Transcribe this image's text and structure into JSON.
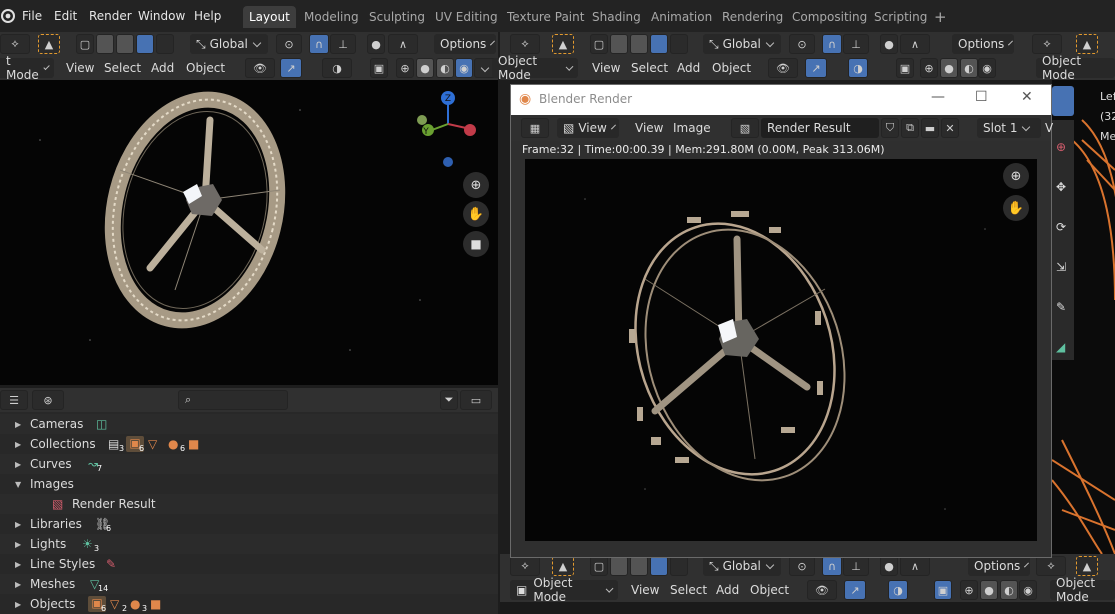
{
  "topbar": {
    "menus": [
      "File",
      "Edit",
      "Render",
      "Window",
      "Help"
    ],
    "workspaces": [
      "Layout",
      "Modeling",
      "Sculpting",
      "UV Editing",
      "Texture Paint",
      "Shading",
      "Animation",
      "Rendering",
      "Compositing",
      "Scripting"
    ],
    "active_workspace": "Layout",
    "add_tab": "+"
  },
  "tool_header": {
    "transform_orientation": "Global",
    "options_label": "Options"
  },
  "viewport_header": {
    "mode": "Object Mode",
    "mode_truncated": "t Mode",
    "menus": [
      "View",
      "Select",
      "Add",
      "Object"
    ]
  },
  "gizmo": {
    "z_label": "Z",
    "y_label": "Y"
  },
  "render_window": {
    "title": "Blender Render",
    "controls": {
      "minimize": "—",
      "maximize": "☐",
      "close": "✕"
    },
    "view_dropdown": "View",
    "menus": [
      "View",
      "Image"
    ],
    "image_name": "Render Result",
    "slot": "Slot 1",
    "slot_cut": "V",
    "stats": "Frame:32 | Time:00:00.39 | Mem:291.80M (0.00M, Peak 313.06M)"
  },
  "outliner": {
    "search_placeholder": "",
    "rows": [
      {
        "label": "Cameras",
        "expanded": false,
        "count": ""
      },
      {
        "label": "Collections",
        "expanded": false,
        "count": "3"
      },
      {
        "label": "Curves",
        "expanded": false,
        "count": "7"
      },
      {
        "label": "Images",
        "expanded": true,
        "count": ""
      },
      {
        "label": "Render Result",
        "child": true,
        "count": ""
      },
      {
        "label": "Libraries",
        "expanded": false,
        "count": "6"
      },
      {
        "label": "Lights",
        "expanded": false,
        "count": "3"
      },
      {
        "label": "Line Styles",
        "expanded": false,
        "count": ""
      },
      {
        "label": "Meshes",
        "expanded": false,
        "count": "14"
      },
      {
        "label": "Objects",
        "expanded": false,
        "count": "6"
      }
    ],
    "extra_counts": {
      "collections_b": "6",
      "collections_c": "6",
      "objects_b": "2",
      "objects_c": "3"
    }
  },
  "right_panel": {
    "lines": [
      "Lef",
      "(32",
      "Me"
    ]
  },
  "colors": {
    "accent": "#4772b3",
    "bg_dark": "#1d1d1d",
    "header": "#303030",
    "orange": "#e0874b"
  }
}
